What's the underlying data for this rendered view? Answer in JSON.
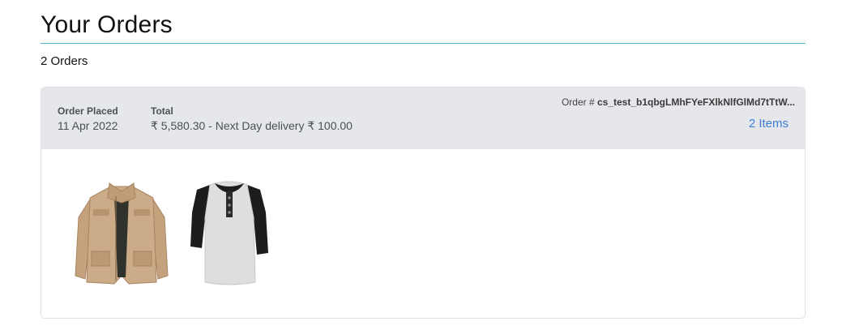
{
  "page": {
    "title": "Your Orders",
    "order_count": "2 Orders"
  },
  "order": {
    "placed_label": "Order Placed",
    "placed_value": "11 Apr 2022",
    "total_label": "Total",
    "total_value": "₹ 5,580.30 - Next Day delivery ₹ 100.00",
    "id_prefix": "Order #",
    "id_value": "cs_test_b1qbgLMhFYeFXlkNlfGlMd7tTtW...",
    "items_link": "2 Items",
    "products": [
      {
        "name": "jacket",
        "color": "#c9ac8a"
      },
      {
        "name": "henley-shirt",
        "color": "#e2e2e2"
      }
    ]
  },
  "colors": {
    "accent_rule": "#4fb8c7",
    "link": "#3d7fd6",
    "header_bg": "#e6e7eb"
  }
}
